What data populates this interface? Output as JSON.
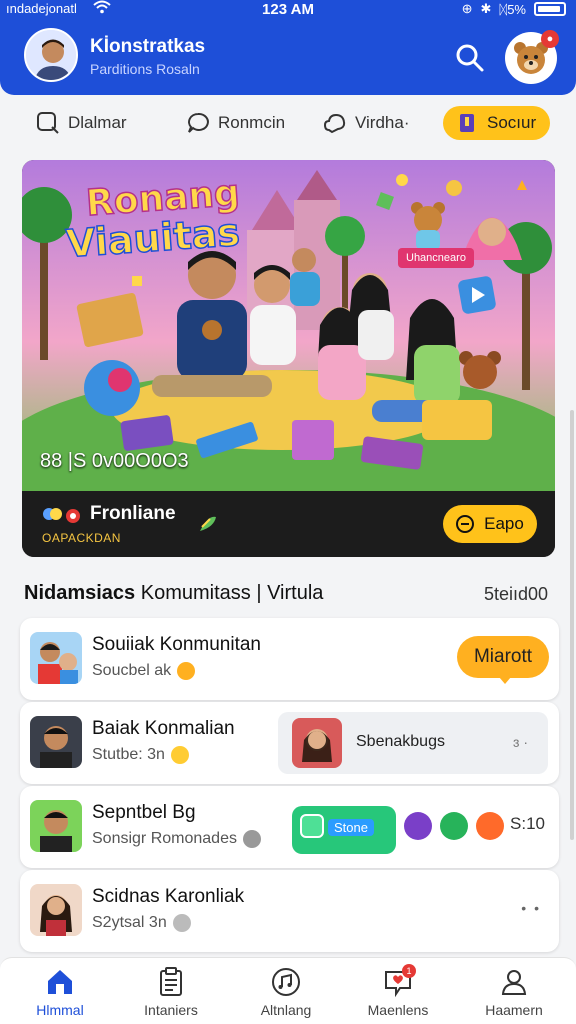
{
  "status_bar": {
    "carrier": "ındadejonatl",
    "time": "123 AM",
    "battery_text": "ᛞ5%"
  },
  "header": {
    "title": "Kİonstratkas",
    "subtitle": "Parditions Rosaln"
  },
  "tabs": [
    {
      "label": "Dlalmar",
      "icon": "search-chat-icon"
    },
    {
      "label": "Ronmcin",
      "icon": "chat-bubble-icon"
    },
    {
      "label": "Virdha·",
      "icon": "chat-cloud-icon"
    },
    {
      "label": "Socıur",
      "icon": "book-icon",
      "active": true
    }
  ],
  "banner": {
    "title_line1": "Ronang",
    "title_line2": "Viauitas",
    "tag": "Uhancnearo",
    "counter": "88 |S 0ᴠ00O0O3",
    "footer_name": "Fronliane",
    "footer_sub": "OAPACKDAN",
    "button_label": "Eapo"
  },
  "section": {
    "title_bold": "Nidamsiacs",
    "title_rest": " Komumitass | Virtula",
    "link": "5teiıd00"
  },
  "list": [
    {
      "name": "Souiiak Konmunitan",
      "sub": "Soucbel ak",
      "action_label": "Miarott"
    },
    {
      "name": "Baiak Konmalian",
      "sub": "Stutbe: 3n",
      "nested_title": "Sbenakbugs",
      "nested_extra": "ɜ ·"
    },
    {
      "name": "Sepntbel Bg",
      "sub": "Sonsigr Romonades",
      "chip_label": "Stone",
      "count": "S:10"
    },
    {
      "name": "Scidnas Karonliak",
      "sub": "S2ytsal 3n",
      "more": "• •"
    }
  ],
  "bottom_nav": [
    {
      "label": "Hlmmal",
      "icon": "home-icon",
      "active": true
    },
    {
      "label": "Intaniers",
      "icon": "clipboard-icon"
    },
    {
      "label": "Altnlang",
      "icon": "music-icon"
    },
    {
      "label": "Maenlens",
      "icon": "heart-chat-icon",
      "badge": "1"
    },
    {
      "label": "Haamern",
      "icon": "profile-icon"
    }
  ],
  "colors": {
    "primary": "#1e4fd8",
    "accent": "#ffc21a",
    "action": "#ffb020"
  }
}
